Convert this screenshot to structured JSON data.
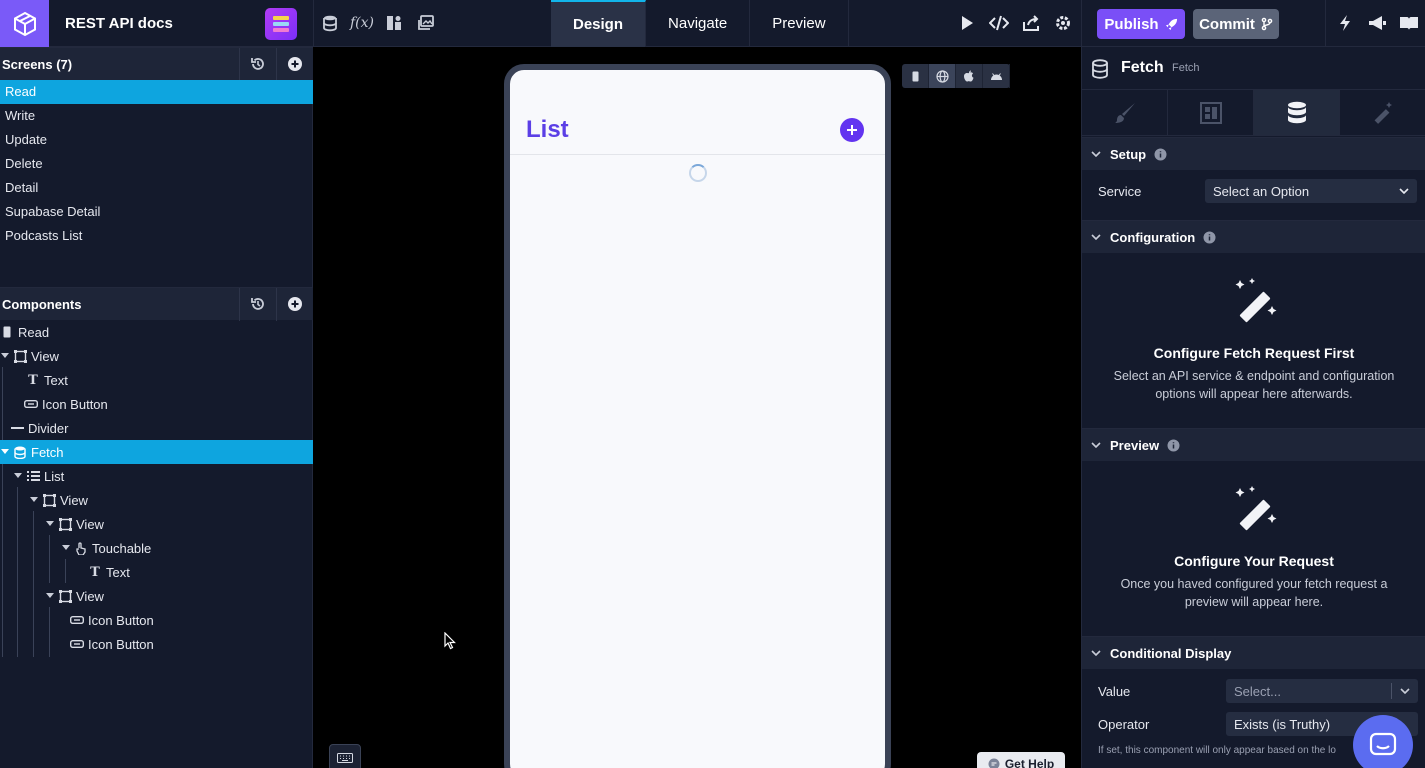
{
  "app": {
    "title": "REST API docs"
  },
  "tabs": [
    "Design",
    "Navigate",
    "Preview"
  ],
  "actions": {
    "publish": "Publish",
    "commit": "Commit"
  },
  "screens": {
    "header": "Screens (7)",
    "items": [
      "Read",
      "Write",
      "Update",
      "Delete",
      "Detail",
      "Supabase Detail",
      "Podcasts List"
    ]
  },
  "components": {
    "header": "Components",
    "tree": [
      {
        "label": "Read",
        "icon": "screen-icon"
      },
      {
        "label": "View",
        "icon": "view-icon"
      },
      {
        "label": "Text",
        "icon": "text-icon"
      },
      {
        "label": "Icon Button",
        "icon": "icon-button-icon"
      },
      {
        "label": "Divider",
        "icon": "divider-icon"
      },
      {
        "label": "Fetch",
        "icon": "database-icon"
      },
      {
        "label": "List",
        "icon": "list-icon"
      },
      {
        "label": "View",
        "icon": "view-icon"
      },
      {
        "label": "View",
        "icon": "view-icon"
      },
      {
        "label": "Touchable",
        "icon": "touch-icon"
      },
      {
        "label": "Text",
        "icon": "text-icon"
      },
      {
        "label": "View",
        "icon": "view-icon"
      },
      {
        "label": "Icon Button",
        "icon": "icon-button-icon"
      },
      {
        "label": "Icon Button",
        "icon": "icon-button-icon"
      }
    ]
  },
  "device": {
    "list_title": "List"
  },
  "help": {
    "label": "Get Help"
  },
  "inspector": {
    "title": "Fetch",
    "subtitle": "Fetch",
    "setup": {
      "title": "Setup",
      "service_label": "Service",
      "service_value": "Select an Option"
    },
    "configuration": {
      "title": "Configuration",
      "heading": "Configure Fetch Request First",
      "body": "Select an API service & endpoint and configuration options will appear here afterwards."
    },
    "preview": {
      "title": "Preview",
      "heading": "Configure Your Request",
      "body": "Once you haved configured your fetch request a preview will appear here."
    },
    "conditional": {
      "title": "Conditional Display",
      "value_label": "Value",
      "value_placeholder": "Select...",
      "operator_label": "Operator",
      "operator_value": "Exists (is Truthy)",
      "note": "If set, this component will only appear based on the lo"
    }
  },
  "colors": {
    "accent": "#7a4ff7",
    "selection": "#0ea5df",
    "list_title": "#5b3fe6"
  }
}
